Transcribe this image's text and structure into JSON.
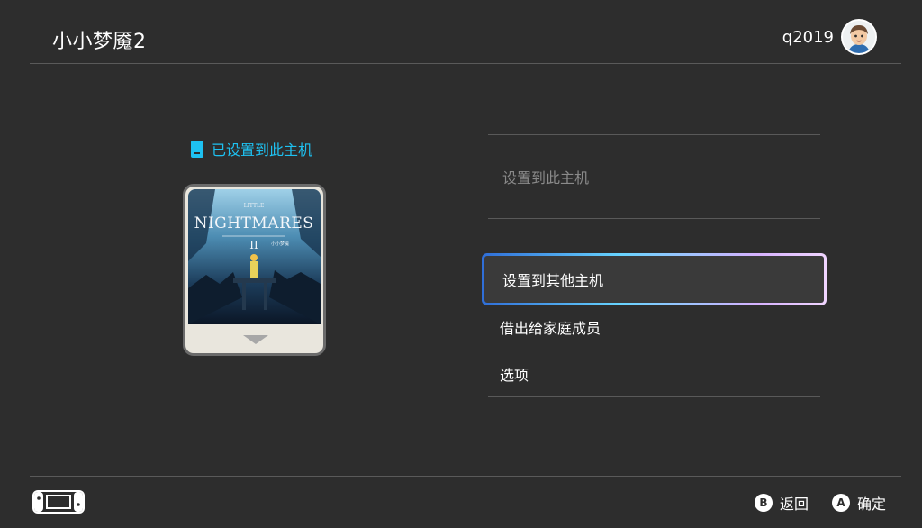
{
  "header": {
    "title": "小小梦魇2",
    "username": "q2019"
  },
  "status": {
    "text": "已设置到此主机"
  },
  "game_card": {
    "art_title": "NIGHTMARES",
    "art_subtitle_top": "LITTLE",
    "art_numeral": "II",
    "art_subtitle_cn": "小小梦魇"
  },
  "menu": {
    "items": [
      {
        "label": "设置到此主机",
        "state": "disabled"
      },
      {
        "label": "设置到其他主机",
        "state": "selected"
      },
      {
        "label": "借出给家庭成员",
        "state": "normal"
      },
      {
        "label": "选项",
        "state": "normal"
      }
    ]
  },
  "footer": {
    "back": {
      "button": "B",
      "label": "返回"
    },
    "confirm": {
      "button": "A",
      "label": "确定"
    }
  },
  "colors": {
    "background": "#2d2d2d",
    "accent": "#1ec1f1",
    "disabled_text": "#8a8a8a"
  }
}
